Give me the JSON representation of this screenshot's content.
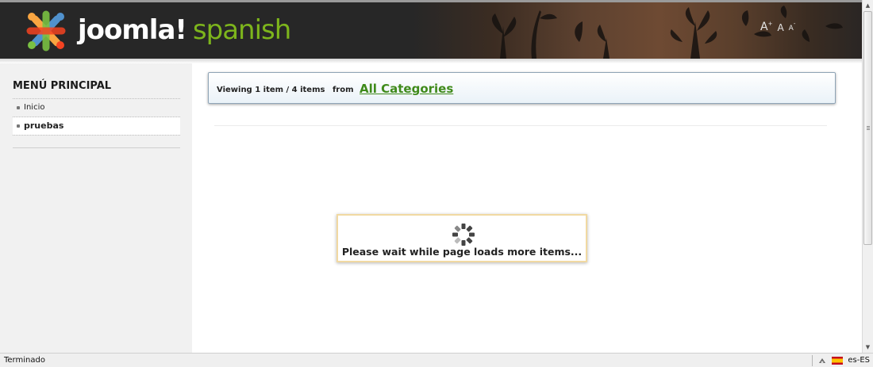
{
  "header": {
    "brand_main": "joomla!",
    "brand_sub": "spanish",
    "font_controls": {
      "increase": "A",
      "reset": "A",
      "decrease": "A"
    }
  },
  "sidebar": {
    "title": "MENÚ PRINCIPAL",
    "items": [
      {
        "label": "Inicio",
        "active": false
      },
      {
        "label": "pruebas",
        "active": true
      }
    ]
  },
  "main": {
    "viewing_text": "Viewing 1 item / 4 items",
    "from_text": "from",
    "category_link": "All Categories",
    "loading_text": "Please wait while page loads more items..."
  },
  "statusbar": {
    "status": "Terminado",
    "locale": "es-ES"
  },
  "colors": {
    "header_bg": "#272727",
    "brand_accent": "#7db51c",
    "link_green": "#3f8a1a",
    "sidebar_bg": "#f1f1f1",
    "loading_border": "#f1d9a2"
  },
  "icons": [
    "joomla-logo-icon",
    "spinner-icon",
    "scroll-up-icon",
    "scroll-down-icon",
    "addon-icon",
    "spain-flag-icon"
  ]
}
